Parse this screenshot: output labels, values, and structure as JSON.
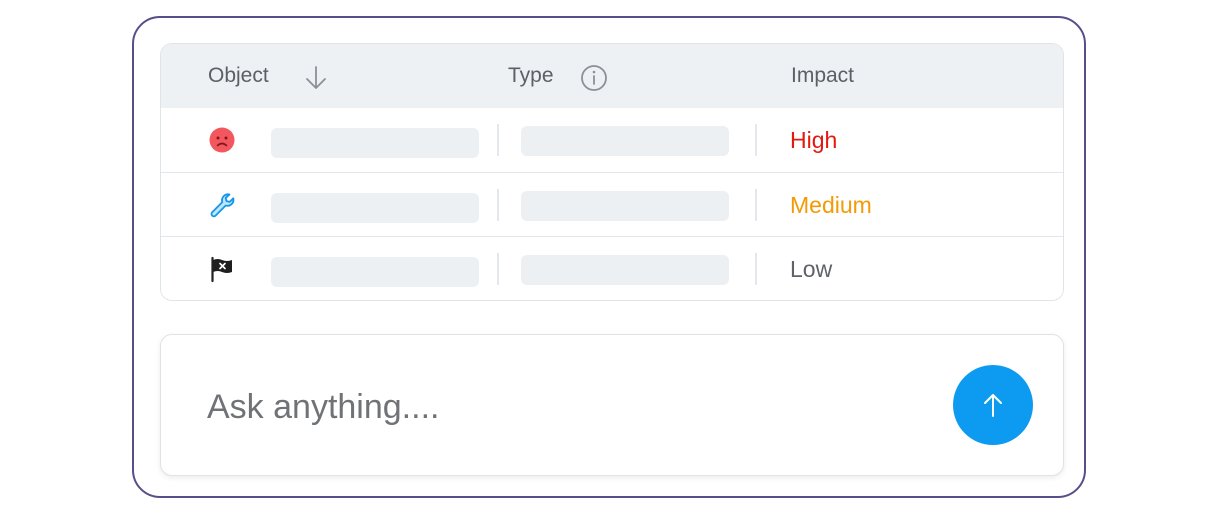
{
  "table": {
    "columns": [
      {
        "label": "Object",
        "icon": "arrow-down-icon"
      },
      {
        "label": "Type",
        "icon": "info-icon"
      },
      {
        "label": "Impact",
        "icon": ""
      }
    ],
    "rows": [
      {
        "icon": "sad-face-icon",
        "impact": "High",
        "impact_color": "#e4180f"
      },
      {
        "icon": "wrench-icon",
        "impact": "Medium",
        "impact_color": "#f39a06"
      },
      {
        "icon": "pirate-flag-icon",
        "impact": "Low",
        "impact_color": "#5f6368"
      }
    ]
  },
  "composer": {
    "placeholder": "Ask anything....",
    "send_icon": "arrow-up-icon",
    "accent_color": "#0d9bf2"
  },
  "frame": {
    "border_color": "#56508a"
  }
}
